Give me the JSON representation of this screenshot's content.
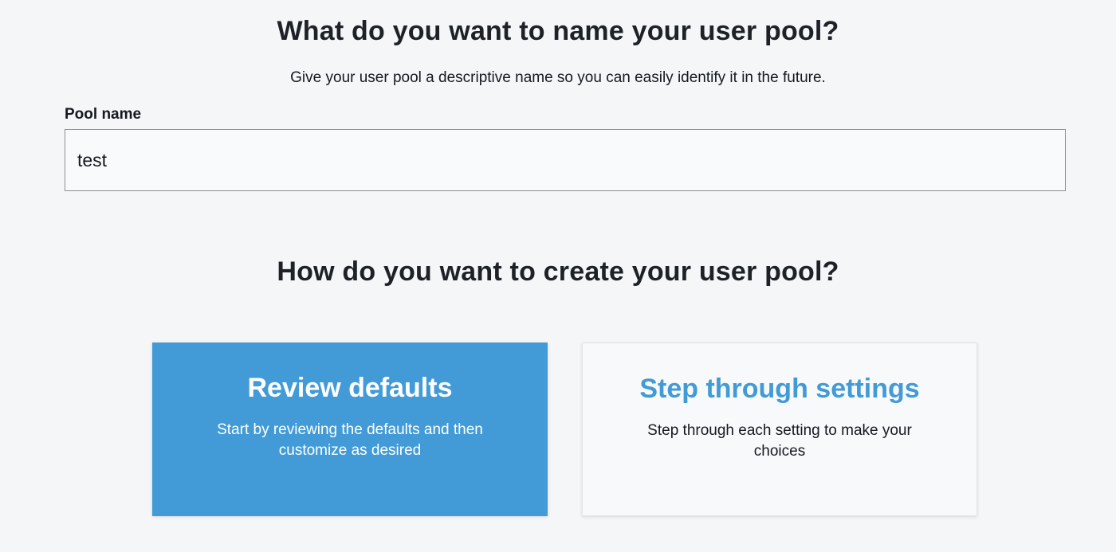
{
  "naming": {
    "title": "What do you want to name your user pool?",
    "subtitle": "Give your user pool a descriptive name so you can easily identify it in the future.",
    "field_label": "Pool name",
    "field_value": "test"
  },
  "creation": {
    "title": "How do you want to create your user pool?",
    "options": [
      {
        "title": "Review defaults",
        "description": "Start by reviewing the defaults and then customize as desired",
        "selected": true
      },
      {
        "title": "Step through settings",
        "description": "Step through each setting to make your choices",
        "selected": false
      }
    ]
  },
  "colors": {
    "accent": "#429bd6",
    "background": "#f4f6f8",
    "text": "#16191f"
  }
}
